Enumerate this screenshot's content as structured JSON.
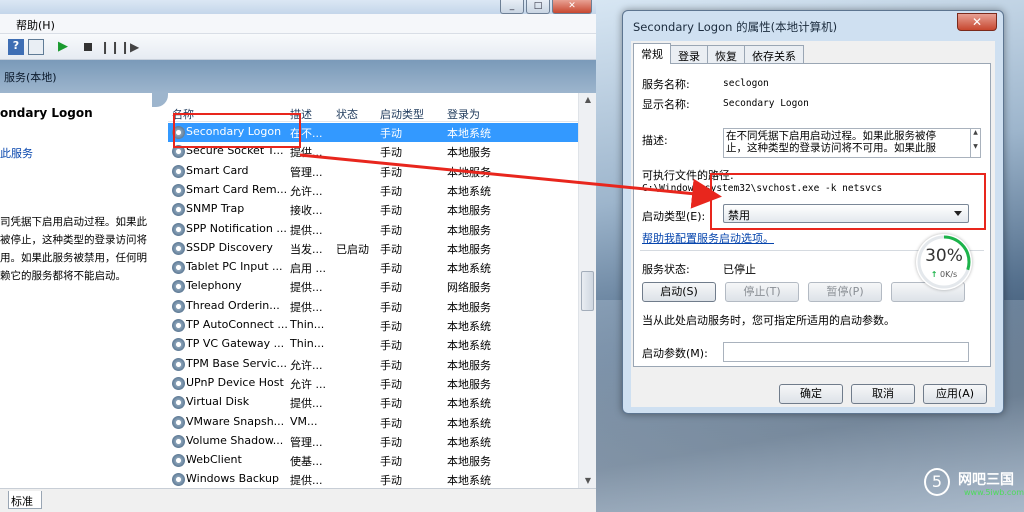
{
  "services_window": {
    "menu": [
      "帮助(H)"
    ],
    "scope_title": "服务(本地)",
    "description_pane": {
      "service_title": "ondary Logon",
      "action_link": "此服务",
      "description": "司凭据下启用启动过程。如果此\n被停止，这种类型的登录访问将\n用。如果此服务被禁用，任何明\n赖它的服务都将不能启动。"
    },
    "columns": [
      "名称",
      "描述",
      "状态",
      "启动类型",
      "登录为"
    ],
    "rows": [
      {
        "name": "Secondary Logon",
        "desc": "在不...",
        "status": "",
        "startup": "手动",
        "logon": "本地系统",
        "selected": true
      },
      {
        "name": "Secure Socket T...",
        "desc": "提供...",
        "status": "",
        "startup": "手动",
        "logon": "本地服务"
      },
      {
        "name": "Smart Card",
        "desc": "管理...",
        "status": "",
        "startup": "手动",
        "logon": "本地服务"
      },
      {
        "name": "Smart Card Rem...",
        "desc": "允许...",
        "status": "",
        "startup": "手动",
        "logon": "本地系统"
      },
      {
        "name": "SNMP Trap",
        "desc": "接收...",
        "status": "",
        "startup": "手动",
        "logon": "本地服务"
      },
      {
        "name": "SPP Notification ...",
        "desc": "提供...",
        "status": "",
        "startup": "手动",
        "logon": "本地服务"
      },
      {
        "name": "SSDP Discovery",
        "desc": "当发...",
        "status": "已启动",
        "startup": "手动",
        "logon": "本地服务"
      },
      {
        "name": "Tablet PC Input ...",
        "desc": "启用 ...",
        "status": "",
        "startup": "手动",
        "logon": "本地系统"
      },
      {
        "name": "Telephony",
        "desc": "提供...",
        "status": "",
        "startup": "手动",
        "logon": "网络服务"
      },
      {
        "name": "Thread Orderin...",
        "desc": "提供...",
        "status": "",
        "startup": "手动",
        "logon": "本地服务"
      },
      {
        "name": "TP AutoConnect ...",
        "desc": "Thin...",
        "status": "",
        "startup": "手动",
        "logon": "本地系统"
      },
      {
        "name": "TP VC Gateway ...",
        "desc": "Thin...",
        "status": "",
        "startup": "手动",
        "logon": "本地系统"
      },
      {
        "name": "TPM Base Servic...",
        "desc": "允许...",
        "status": "",
        "startup": "手动",
        "logon": "本地服务"
      },
      {
        "name": "UPnP Device Host",
        "desc": "允许 ...",
        "status": "",
        "startup": "手动",
        "logon": "本地服务"
      },
      {
        "name": "Virtual Disk",
        "desc": "提供...",
        "status": "",
        "startup": "手动",
        "logon": "本地系统"
      },
      {
        "name": "VMware Snapsh...",
        "desc": "VM...",
        "status": "",
        "startup": "手动",
        "logon": "本地系统"
      },
      {
        "name": "Volume Shadow...",
        "desc": "管理...",
        "status": "",
        "startup": "手动",
        "logon": "本地系统"
      },
      {
        "name": "WebClient",
        "desc": "使基...",
        "status": "",
        "startup": "手动",
        "logon": "本地服务"
      },
      {
        "name": "Windows Backup",
        "desc": "提供...",
        "status": "",
        "startup": "手动",
        "logon": "本地系统"
      }
    ],
    "status_tab": "标准"
  },
  "dialog": {
    "title": "Secondary Logon 的属性(本地计算机)",
    "tabs": [
      "常规",
      "登录",
      "恢复",
      "依存关系"
    ],
    "service_name_label": "服务名称:",
    "service_name": "seclogon",
    "display_name_label": "显示名称:",
    "display_name": "Secondary Logon",
    "description_label": "描述:",
    "description": "在不同凭据下启用启动过程。如果此服务被停\n止，这种类型的登录访问将不可用。如果此服",
    "path_label": "可执行文件的路径:",
    "path": "C:\\Windows\\system32\\svchost.exe -k netsvcs",
    "startup_type_label": "启动类型(E):",
    "startup_type": "禁用",
    "help_link": "帮助我配置服务启动选项。",
    "status_label": "服务状态:",
    "status_value": "已停止",
    "buttons": {
      "start": "启动(S)",
      "stop": "停止(T)",
      "pause": "暂停(P)"
    },
    "hint": "当从此处启动服务时，您可指定所适用的启动参数。",
    "param_label": "启动参数(M):",
    "ok": "确定",
    "cancel": "取消",
    "apply": "应用(A)"
  },
  "gauge": {
    "percent": "30%",
    "speed": "0K/s",
    "fraction": 0.3
  },
  "watermark": {
    "name": "网吧三国",
    "url": "www.5iwb.com"
  },
  "colors": {
    "selection": "#3399ff",
    "highlight": "#e8261d",
    "gauge": "#1cb34a"
  }
}
